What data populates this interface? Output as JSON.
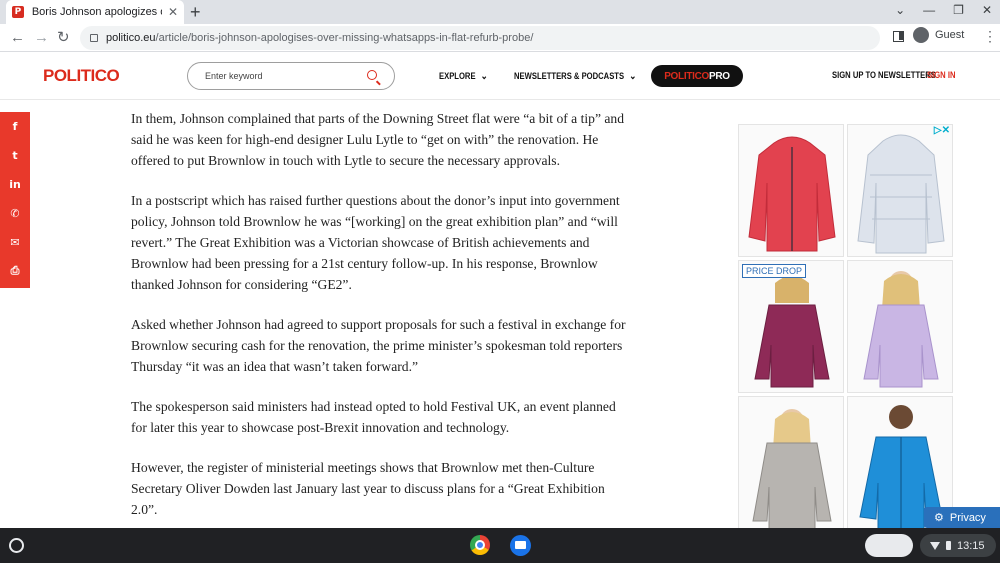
{
  "browser": {
    "tab_title": "Boris Johnson apologizes over m",
    "tab_favicon": "P",
    "tab_close": "✕",
    "new_tab": "+",
    "url_host": "politico.eu",
    "url_path": "/article/boris-johnson-apologises-over-missing-whatsapps-in-flat-refurb-probe/",
    "profile_label": "Guest",
    "back_glyph": "←",
    "forward_glyph": "→",
    "reload_glyph": "↻",
    "kebab_glyph": "⋮",
    "window_controls": [
      "⌄",
      "—",
      "❐",
      "✕"
    ]
  },
  "site": {
    "logo": "POLITICO",
    "search_placeholder": "Enter keyword",
    "nav": {
      "explore": "EXPLORE",
      "newsletters": "NEWSLETTERS & PODCASTS",
      "chevron": "⌄",
      "pro_part1": "POLITICO",
      "pro_part2": "PRO",
      "signup": "SIGN UP TO NEWSLETTERS",
      "signin": "SIGN IN"
    }
  },
  "share": {
    "facebook": "f",
    "twitter": "t",
    "linkedin": "in",
    "whatsapp": "✆",
    "email": "✉",
    "print": "⎙"
  },
  "article": {
    "paragraphs": [
      "In them, Johnson complained that parts of the Downing Street flat were “a bit of a tip” and said he was keen for high-end designer Lulu Lytle to “get on with” the renovation. He offered to put Brownlow in touch with Lytle to secure the necessary approvals.",
      "In a postscript which has raised further questions about the donor’s input into government policy, Johnson told Brownlow he was “[working] on the great exhibition plan” and “will revert.” The Great Exhibition was a Victorian showcase of British achievements and Brownlow had been pressing for a 21st century follow-up. In his response, Brownlow thanked Johnson for considering “GE2”.",
      "Asked whether Johnson had agreed to support proposals for such a festival in exchange for Brownlow securing cash for the renovation, the prime minister’s spokesman told reporters Thursday “it was an idea that wasn’t taken forward.”",
      "The spokesperson said ministers had instead opted to hold Festival UK, an event planned for later this year to showcase post-Brexit innovation and technology.",
      "However, the register of ministerial meetings shows that Brownlow met then-Culture Secretary Oliver Dowden last January last year to discuss plans for a “Great Exhibition 2.0”."
    ]
  },
  "ad": {
    "choices": "▷✕",
    "price_drop": "PRICE DROP",
    "jackets": [
      {
        "color": "#e2424f",
        "accent": "#c22c3a"
      },
      {
        "color": "#dde3ec",
        "accent": "#b7c1cf"
      },
      {
        "color": "#8e2a57",
        "accent": "#6c1f41"
      },
      {
        "color": "#c9b6e4",
        "accent": "#a993cc"
      },
      {
        "color": "#b7b4b0",
        "accent": "#8f8c88"
      },
      {
        "color": "#1f8fd8",
        "accent": "#136aa8"
      }
    ],
    "privacy_label": "Privacy",
    "privacy_icon": "⚙"
  },
  "shelf": {
    "time": "13:15"
  }
}
